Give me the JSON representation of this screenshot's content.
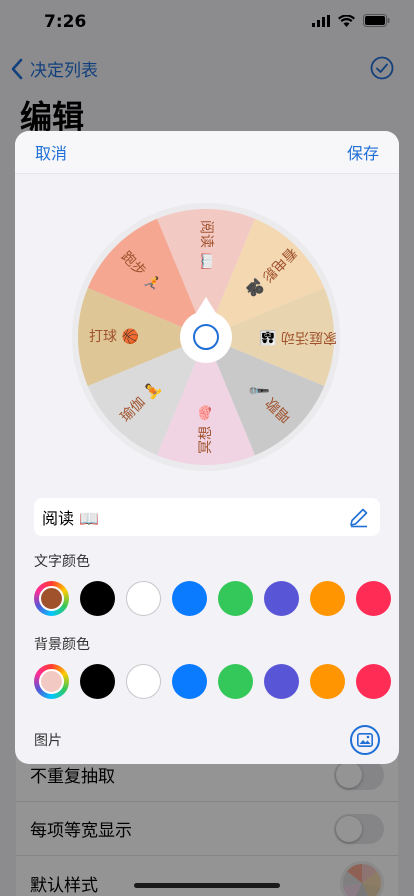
{
  "status": {
    "time": "7:26"
  },
  "nav": {
    "back_label": "决定列表",
    "title": "编辑"
  },
  "modal": {
    "cancel_label": "取消",
    "save_label": "保存",
    "segments": [
      {
        "label": "阅读",
        "emoji": "📖",
        "color": "#f3c9c4"
      },
      {
        "label": "看电影",
        "emoji": "🎥",
        "color": "#f3d8b2"
      },
      {
        "label": "家庭活动",
        "emoji": "👨‍👩‍👧",
        "color": "#e8d4ae"
      },
      {
        "label": "唱歌",
        "emoji": "🎤",
        "color": "#c9c9c9"
      },
      {
        "label": "冥想",
        "emoji": "🧠",
        "color": "#f0d4e3"
      },
      {
        "label": "瑜伽",
        "emoji": "🧘",
        "color": "#dadada"
      },
      {
        "label": "打球",
        "emoji": "🏀",
        "color": "#dfc697"
      },
      {
        "label": "跑步",
        "emoji": "🏃",
        "color": "#f5a791"
      }
    ],
    "item_value": "阅读 📖",
    "text_color_label": "文字颜色",
    "bg_color_label": "背景颜色",
    "text_colors": [
      "#000000",
      "#ffffff",
      "#0a7aff",
      "#34c759",
      "#5856d6",
      "#ff9500",
      "#ff2d55"
    ],
    "bg_colors": [
      "#000000",
      "#ffffff",
      "#0a7aff",
      "#34c759",
      "#5856d6",
      "#ff9500",
      "#ff2d55"
    ],
    "current_text_color": "#a0522d",
    "current_bg_color": "#f3c9c4",
    "image_label": "图片"
  },
  "settings": [
    {
      "label": "不重复抽取"
    },
    {
      "label": "每项等宽显示"
    },
    {
      "label": "默认样式"
    }
  ],
  "accent": "#1f6fd6",
  "text_color_on_wheel": "#a0522d"
}
